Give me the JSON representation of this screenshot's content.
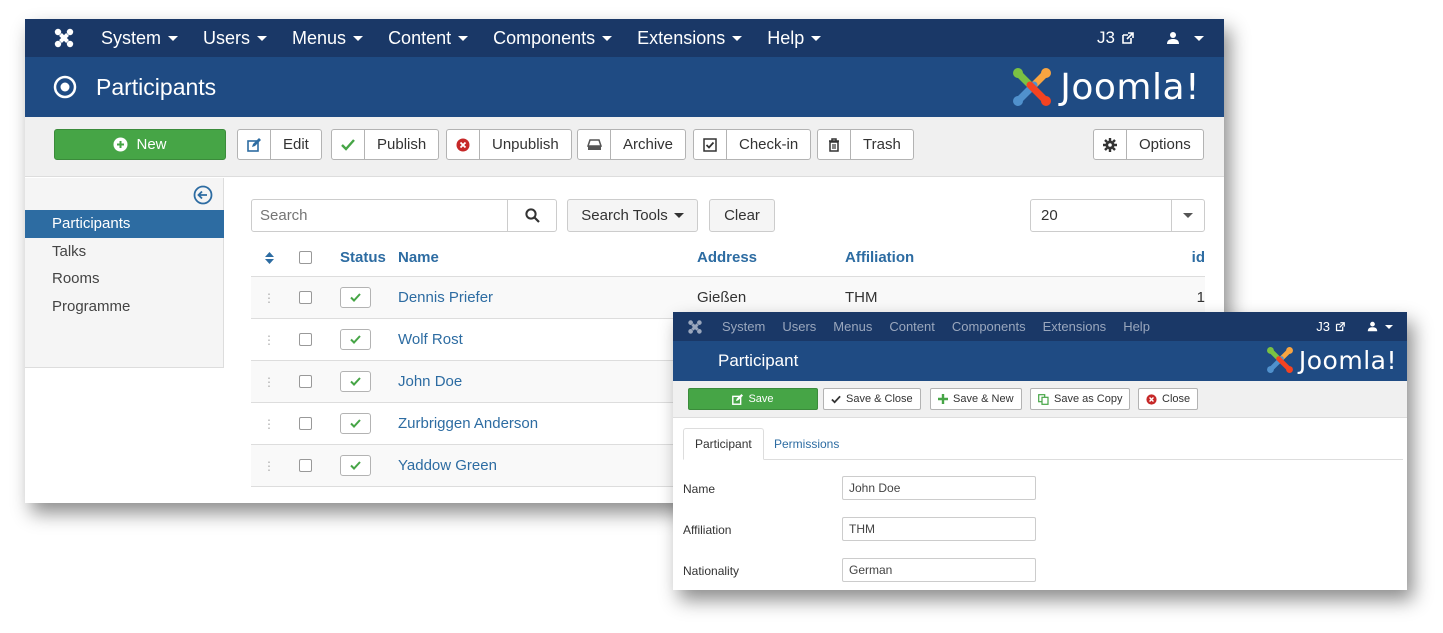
{
  "main": {
    "topbar": {
      "menus": [
        "System",
        "Users",
        "Menus",
        "Content",
        "Components",
        "Extensions",
        "Help"
      ],
      "site_label": "J3",
      "user_icon": "user-icon"
    },
    "title": "Participants",
    "logo_text": "Joomla!",
    "toolbar": {
      "new": "New",
      "edit": "Edit",
      "publish": "Publish",
      "unpublish": "Unpublish",
      "archive": "Archive",
      "checkin": "Check-in",
      "trash": "Trash",
      "options": "Options"
    },
    "sidebar": {
      "items": [
        {
          "label": "Participants",
          "active": true
        },
        {
          "label": "Talks",
          "active": false
        },
        {
          "label": "Rooms",
          "active": false
        },
        {
          "label": "Programme",
          "active": false
        }
      ]
    },
    "filters": {
      "search_placeholder": "Search",
      "search_tools": "Search Tools",
      "clear": "Clear",
      "limit": "20"
    },
    "table": {
      "headers": {
        "status": "Status",
        "name": "Name",
        "address": "Address",
        "affiliation": "Affiliation",
        "id": "id"
      },
      "rows": [
        {
          "name": "Dennis Priefer",
          "address": "Gießen",
          "affiliation": "THM",
          "id": "1"
        },
        {
          "name": "Wolf Rost",
          "address": "",
          "affiliation": "",
          "id": ""
        },
        {
          "name": "John Doe",
          "address": "",
          "affiliation": "",
          "id": ""
        },
        {
          "name": "Zurbriggen Anderson",
          "address": "",
          "affiliation": "",
          "id": ""
        },
        {
          "name": "Yaddow Green",
          "address": "",
          "affiliation": "",
          "id": ""
        }
      ]
    }
  },
  "edit": {
    "topbar": {
      "menus": [
        "System",
        "Users",
        "Menus",
        "Content",
        "Components",
        "Extensions",
        "Help"
      ],
      "site_label": "J3"
    },
    "title": "Participant",
    "logo_text": "Joomla!",
    "toolbar": {
      "save": "Save",
      "save_close": "Save & Close",
      "save_new": "Save & New",
      "save_copy": "Save as Copy",
      "close": "Close"
    },
    "tabs": [
      "Participant",
      "Permissions"
    ],
    "fields": [
      {
        "label": "Name",
        "value": "John Doe"
      },
      {
        "label": "Affiliation",
        "value": "THM"
      },
      {
        "label": "Nationality",
        "value": "German"
      }
    ]
  },
  "colors": {
    "topbar": "#1a3867",
    "titlebar": "#1f4b83",
    "success": "#46a546",
    "link": "#2d6ca2",
    "danger": "#c62828"
  }
}
